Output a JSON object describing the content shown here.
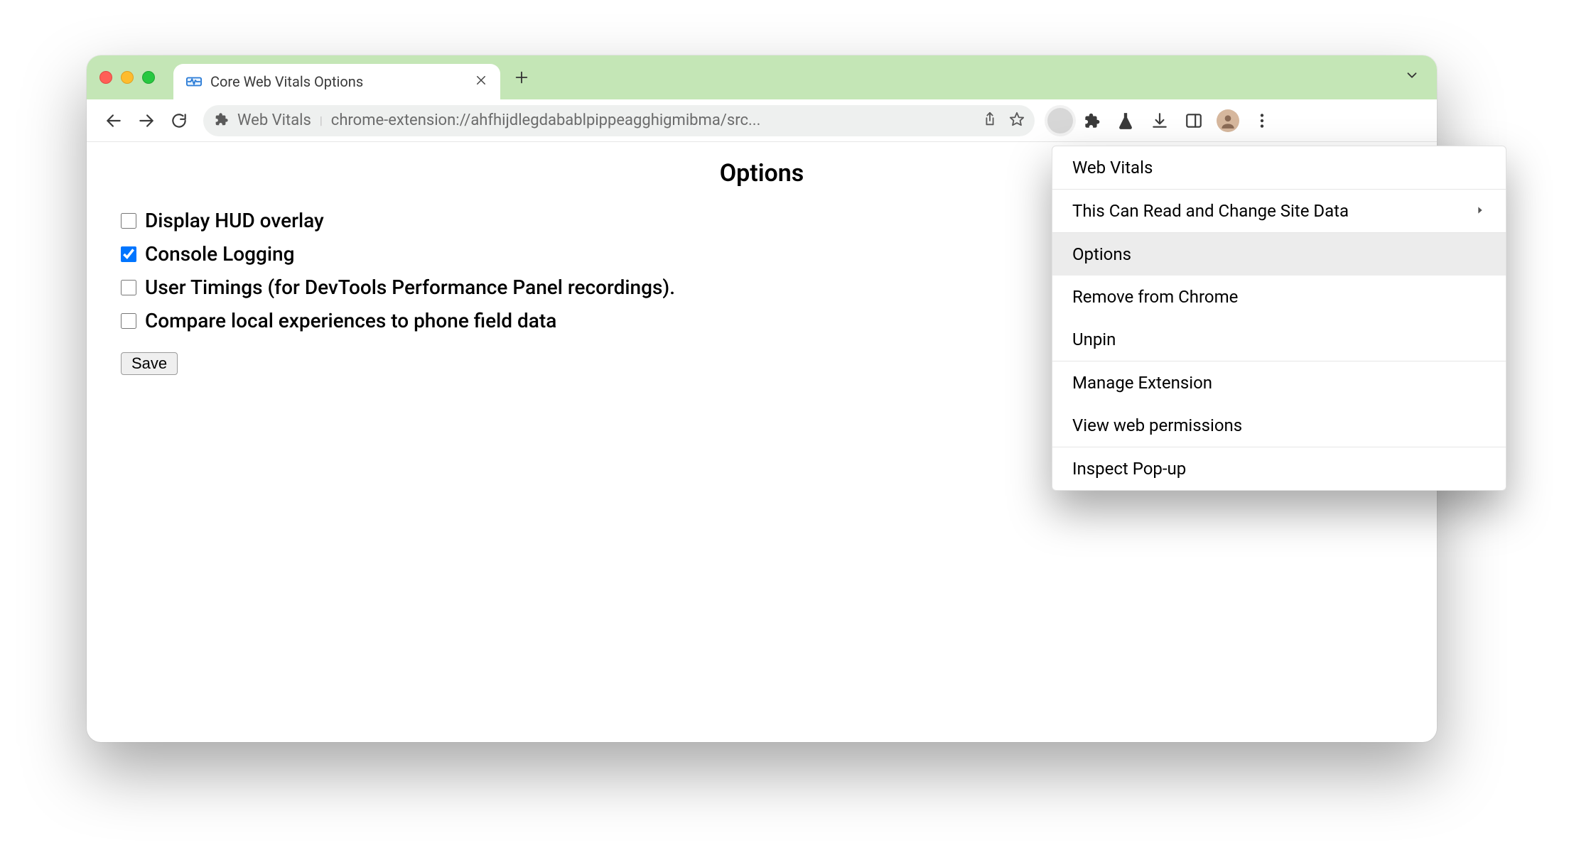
{
  "tab": {
    "title": "Core Web Vitals Options"
  },
  "omnibox": {
    "extension_name": "Web Vitals",
    "url": "chrome-extension://ahfhijdlegdabablpippeagghigmibma/src..."
  },
  "page": {
    "heading": "Options",
    "options": [
      {
        "label": "Display HUD overlay",
        "checked": false
      },
      {
        "label": "Console Logging",
        "checked": true
      },
      {
        "label": "User Timings (for DevTools Performance Panel recordings).",
        "checked": false
      },
      {
        "label": "Compare local experiences to phone field data",
        "checked": false
      }
    ],
    "save_label": "Save"
  },
  "context_menu": {
    "header": "Web Vitals",
    "items": [
      {
        "label": "This Can Read and Change Site Data",
        "submenu": true,
        "sep_before": true
      },
      {
        "label": "Options",
        "highlight": true,
        "sep_before": true
      },
      {
        "label": "Remove from Chrome"
      },
      {
        "label": "Unpin"
      },
      {
        "label": "Manage Extension",
        "sep_before": true
      },
      {
        "label": "View web permissions"
      },
      {
        "label": "Inspect Pop-up",
        "sep_before": true
      }
    ]
  }
}
